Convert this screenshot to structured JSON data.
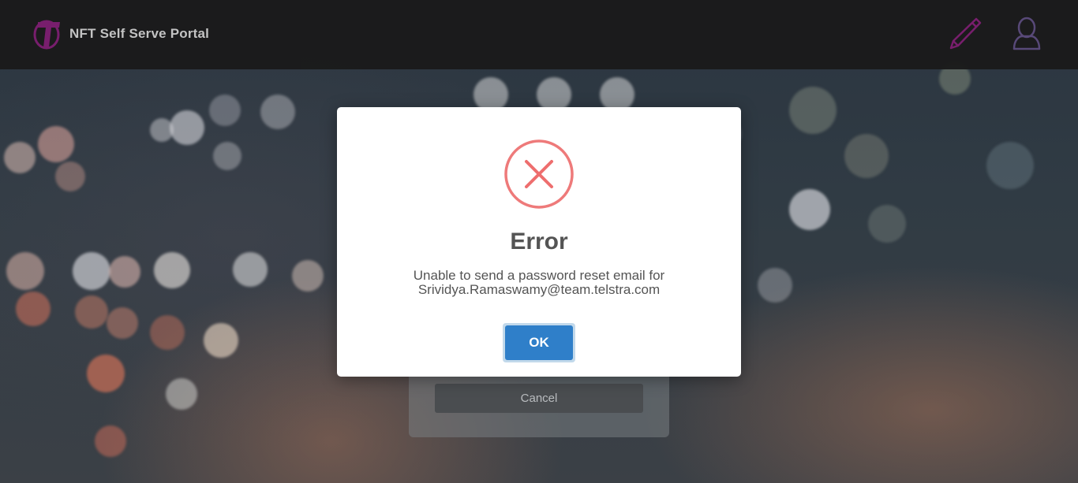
{
  "header": {
    "title": "NFT Self Serve Portal",
    "logo_icon": "telstra-logo",
    "edit_icon": "pencil-icon",
    "user_icon": "user-icon",
    "accent_color": "#7b1e6f"
  },
  "background_form": {
    "cancel_label": "Cancel"
  },
  "dialog": {
    "icon": "error-x-circle-icon",
    "icon_color": "#ee7a7a",
    "title": "Error",
    "message_line1": "Unable to send a password reset email for",
    "message_line2": "Srividya.Ramaswamy@team.telstra.com",
    "ok_label": "OK",
    "ok_color": "#2f7fc9"
  }
}
